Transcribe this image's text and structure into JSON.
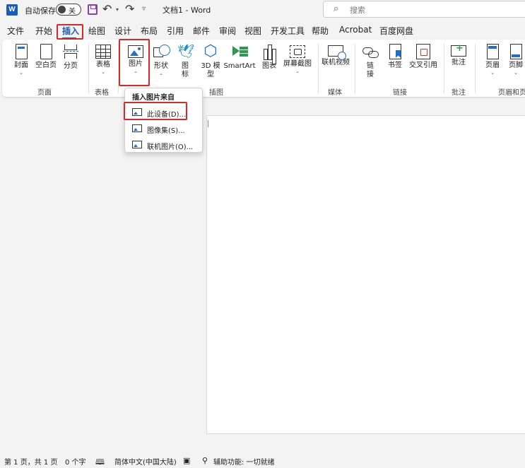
{
  "titlebar": {
    "app_logo": "W",
    "autosave_label": "自动保存",
    "autosave_state": "关",
    "doc_title": "文档1 - Word",
    "search_placeholder": "搜索",
    "icons": [
      "word-logo-icon",
      "save-icon",
      "undo-icon",
      "redo-icon",
      "customize-qat-icon",
      "search-icon"
    ]
  },
  "tabs": [
    "文件",
    "开始",
    "插入",
    "绘图",
    "设计",
    "布局",
    "引用",
    "邮件",
    "审阅",
    "视图",
    "开发工具",
    "帮助",
    "Acrobat",
    "百度网盘"
  ],
  "active_tab": "插入",
  "ribbon": {
    "pages": {
      "cover": "封面",
      "blank": "空白页",
      "break": "分页",
      "group": "页面"
    },
    "tables": {
      "table": "表格",
      "group": "表格"
    },
    "illustrations": {
      "pictures": "图片",
      "shapes": "形状",
      "icons_a": "图",
      "icons_b": "标",
      "model_a": "3D 模",
      "model_b": "型",
      "smartart": "SmartArt",
      "chart": "图表",
      "screenshot": "屏幕截图",
      "group": "插图"
    },
    "media": {
      "online_video": "联机视频",
      "group": "媒体"
    },
    "links": {
      "link_a": "链",
      "link_b": "接",
      "bookmark": "书签",
      "xref": "交叉引用",
      "group": "链接"
    },
    "comments": {
      "comment": "批注",
      "group": "批注"
    },
    "header_footer": {
      "header": "页眉",
      "footer": "页脚",
      "group": "页眉和页"
    }
  },
  "picture_menu": {
    "title": "插入图片来自",
    "items": [
      "此设备(D)...",
      "图像集(S)...",
      "联机图片(O)..."
    ]
  },
  "statusbar": {
    "page": "第 1 页，共 1 页",
    "words": "0 个字",
    "language": "简体中文(中国大陆)",
    "accessibility": "辅助功能: 一切就绪"
  },
  "colors": {
    "accent": "#1e5cb3",
    "highlight_box": "#d62a2a"
  }
}
